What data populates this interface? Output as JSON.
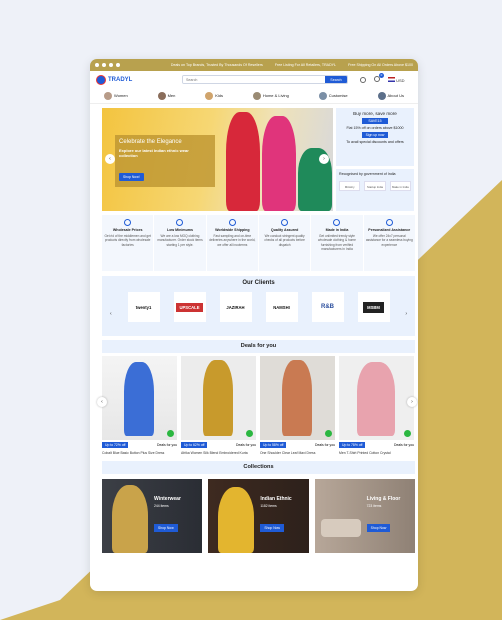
{
  "topbar": {
    "messages": [
      "Deals on Top Brands, Trusted By Thousands Of Resellers",
      "Free Listing For All Retailers, TRADYL",
      "Free Shipping On All Orders Above $100"
    ]
  },
  "header": {
    "logo": "TRADYL",
    "search_placeholder": "Search",
    "search_button": "Search",
    "cart_count": "0",
    "currency": "USD"
  },
  "categories": [
    "Women",
    "Men",
    "Kids",
    "Home & Living",
    "Customise",
    "About Us"
  ],
  "hero": {
    "title": "Celebrate the Elegance",
    "subtitle": "Explore our latest Indian ethnic wear collection",
    "button": "Shop Now!"
  },
  "promo": {
    "title": "Buy more, save more",
    "code": "SAVE15",
    "text": "Flat 15% off on orders above $1000",
    "button": "Sign up now",
    "footer": "To avail special discounts and offers"
  },
  "gov": {
    "title": "Recognised by government of India",
    "logos": [
      "Ministry",
      "Startup India",
      "Make in India"
    ]
  },
  "features": [
    {
      "title": "Wholesale Prices",
      "text": "Get rid of the middlemen and get products directly from wholesale factories"
    },
    {
      "title": "Low Minimums",
      "text": "We are a low MOQ clothing manufacturer. Order stock items starting 1 per style."
    },
    {
      "title": "Worldwide Shipping",
      "text": "Fast sampling and on-time deliveries anywhere in the world, we offer all incoterms"
    },
    {
      "title": "Quality Assured",
      "text": "We conduct stringent quality checks of all products before dispatch"
    },
    {
      "title": "Made in India",
      "text": "Get unlimited trendy style wholesale clothing & home furnishing from verified manufacturers in India"
    },
    {
      "title": "Personalized Assistance",
      "text": "We offer 24x7 personal assistance for a seamless buying experience"
    }
  ],
  "clients": {
    "title": "Our Clients",
    "items": [
      "twenty1",
      "UPSCALE",
      "JAZIRAH",
      "NAMSHI",
      "R&B",
      "MSBM"
    ]
  },
  "deals": {
    "title": "Deals for you",
    "items": [
      {
        "off": "Up to 72% off",
        "label": "Deals for you",
        "name": "Cobalt Blue Basic Button Plus Size Dress",
        "color": "#3b6ed6"
      },
      {
        "off": "Up to 62% off",
        "label": "Deals for you",
        "name": "Afrika Women Silk Blend Embroidered Kurta",
        "color": "#c89a2c"
      },
      {
        "off": "Up to 58% off",
        "label": "Deals for you",
        "name": "One Shoulder Clear Leaf Maxi Dress",
        "color": "#c97a52"
      },
      {
        "off": "Up to 78% off",
        "label": "Deals for you",
        "name": "Men T-Shirt Printed Cotton Crystal",
        "color": "#e8a3ae"
      }
    ]
  },
  "collections": {
    "title": "Collections",
    "items": [
      {
        "title": "Winterwear",
        "count": "244 items",
        "button": "Shop Now"
      },
      {
        "title": "Indian Ethnic",
        "count": "1182 items",
        "button": "Shop Now"
      },
      {
        "title": "Living & Floor",
        "count": "723 items",
        "button": "Shop Now"
      }
    ]
  }
}
